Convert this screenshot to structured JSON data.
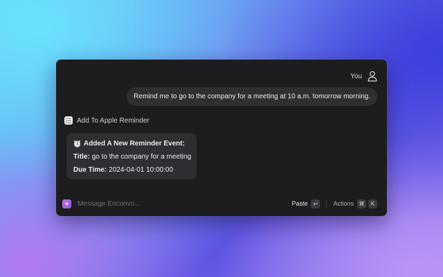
{
  "user": {
    "name": "You",
    "icon": "person-icon"
  },
  "messages": {
    "user_text": "Remind me to go to the company for a meeting at 10 a.m. tomorrow morning.",
    "tool": {
      "label": "Add To Apple Reminder",
      "icon": "list-icon"
    },
    "ai": {
      "emoji": "alarm-clock-icon",
      "heading": "Added A New Reminder Event:",
      "title_label": "Title:",
      "title_value": "go to the company for a meeting",
      "due_label": "Due Time:",
      "due_value": "2024-04-01 10:00:00"
    }
  },
  "footer": {
    "placeholder": "Message Enconvo...",
    "paste_label": "Paste",
    "paste_key": "↩",
    "actions_label": "Actions",
    "actions_keys": [
      "⌘",
      "K"
    ]
  },
  "colors": {
    "window_bg": "#1d1d20",
    "bubble_bg": "#2e2e33",
    "text": "#ececf0",
    "muted": "#6c6c73",
    "app_icon": "#b565dc"
  }
}
